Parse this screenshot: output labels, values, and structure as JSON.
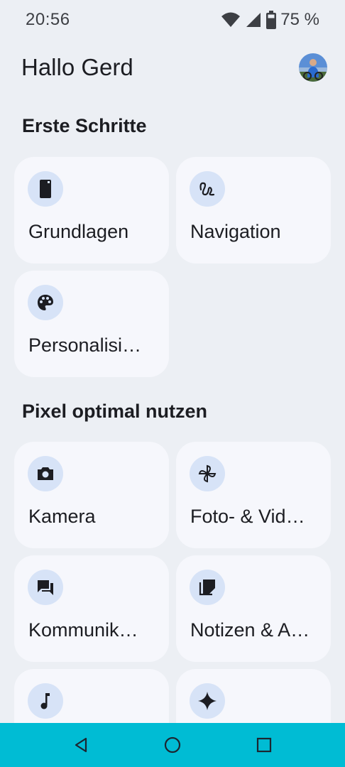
{
  "status_bar": {
    "time": "20:56",
    "battery": "75 %",
    "icons": [
      "wifi-icon",
      "cell-signal-icon",
      "battery-icon"
    ]
  },
  "header": {
    "greeting": "Hallo Gerd",
    "avatar": "avatar"
  },
  "sections": [
    {
      "title": "Erste Schritte",
      "cards": [
        {
          "label": "Grundlagen",
          "icon": "phone-icon"
        },
        {
          "label": "Navigation",
          "icon": "gesture-icon"
        },
        {
          "label": "Personalisi…",
          "icon": "palette-icon"
        }
      ]
    },
    {
      "title": "Pixel optimal nutzen",
      "cards": [
        {
          "label": "Kamera",
          "icon": "camera-icon"
        },
        {
          "label": "Foto- & Vid…",
          "icon": "pinwheel-icon"
        },
        {
          "label": "Kommunik…",
          "icon": "chat-icon"
        },
        {
          "label": "Notizen & A…",
          "icon": "notes-icon"
        },
        {
          "label": "",
          "icon": "music-note-icon"
        },
        {
          "label": "",
          "icon": "sparkle-icon"
        }
      ]
    }
  ],
  "nav_bar": {
    "color": "#00bcd4",
    "buttons": [
      "back-icon",
      "home-icon",
      "recents-icon"
    ]
  }
}
